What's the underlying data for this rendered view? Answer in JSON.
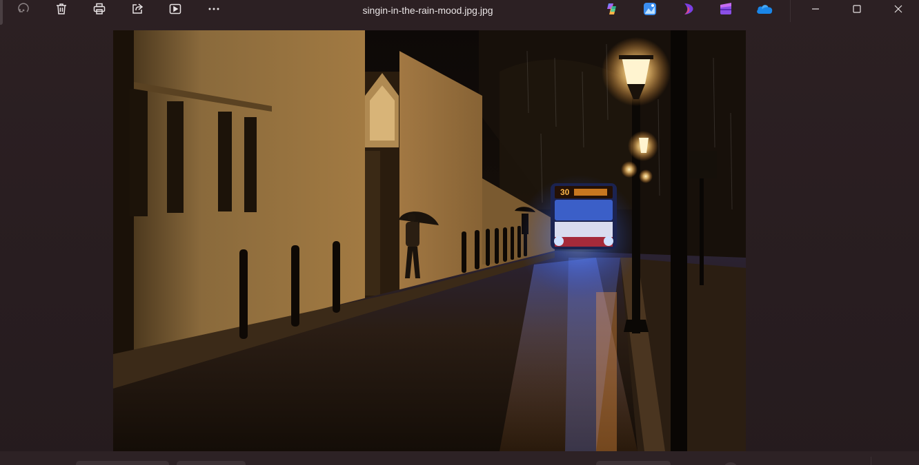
{
  "window": {
    "title": "singin-in-the-rain-mood.jpg.jpg"
  },
  "toolbar": {
    "items": [
      {
        "icon": "rotate-icon",
        "state": "disabled"
      },
      {
        "icon": "trash-icon"
      },
      {
        "icon": "print-icon"
      },
      {
        "icon": "share-icon"
      },
      {
        "icon": "slideshow-icon"
      },
      {
        "icon": "more-icon"
      }
    ]
  },
  "apps": [
    {
      "icon": "copilot-icon"
    },
    {
      "icon": "image-editor-icon"
    },
    {
      "icon": "designer-icon"
    },
    {
      "icon": "clipchamp-icon"
    },
    {
      "icon": "onedrive-icon"
    }
  ],
  "window_controls": [
    {
      "icon": "minimize-icon"
    },
    {
      "icon": "maximize-icon"
    },
    {
      "icon": "close-icon"
    }
  ],
  "photo": {
    "subject": "rainy night street with bus",
    "bus_sign": "30"
  },
  "colors": {
    "background": "#2a1f22",
    "toolbar_text": "#e8e3e4",
    "lamp_glow": "#ffcf7a",
    "bus_light": "#4a7dff"
  }
}
